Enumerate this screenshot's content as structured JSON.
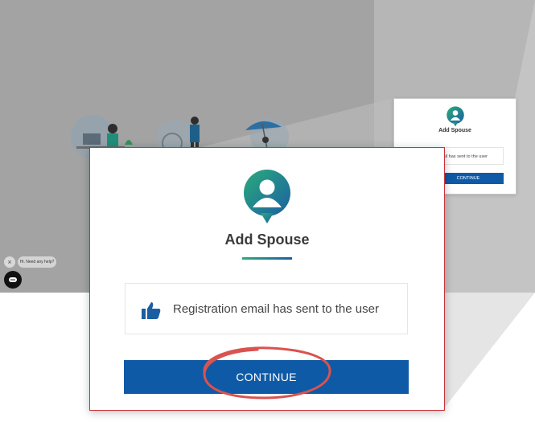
{
  "background": {
    "mini_card": {
      "title": "Add Spouse",
      "message": "email has sent to the user",
      "button_label": "CONTINUE"
    }
  },
  "chat": {
    "close_label": "×",
    "bubble_text": "Hi. Need any help?"
  },
  "modal": {
    "title": "Add Spouse",
    "message": "Registration email has sent to the user",
    "continue_label": "CONTINUE"
  },
  "colors": {
    "primary": "#0f5aa6",
    "accent_green": "#2bab7a",
    "annotation_red": "#d9534f",
    "modal_border": "#c9343a"
  },
  "icons": {
    "avatar": "user-avatar-icon",
    "thumb": "thumbs-up-icon",
    "chat": "chat-icon",
    "close": "close-icon"
  }
}
